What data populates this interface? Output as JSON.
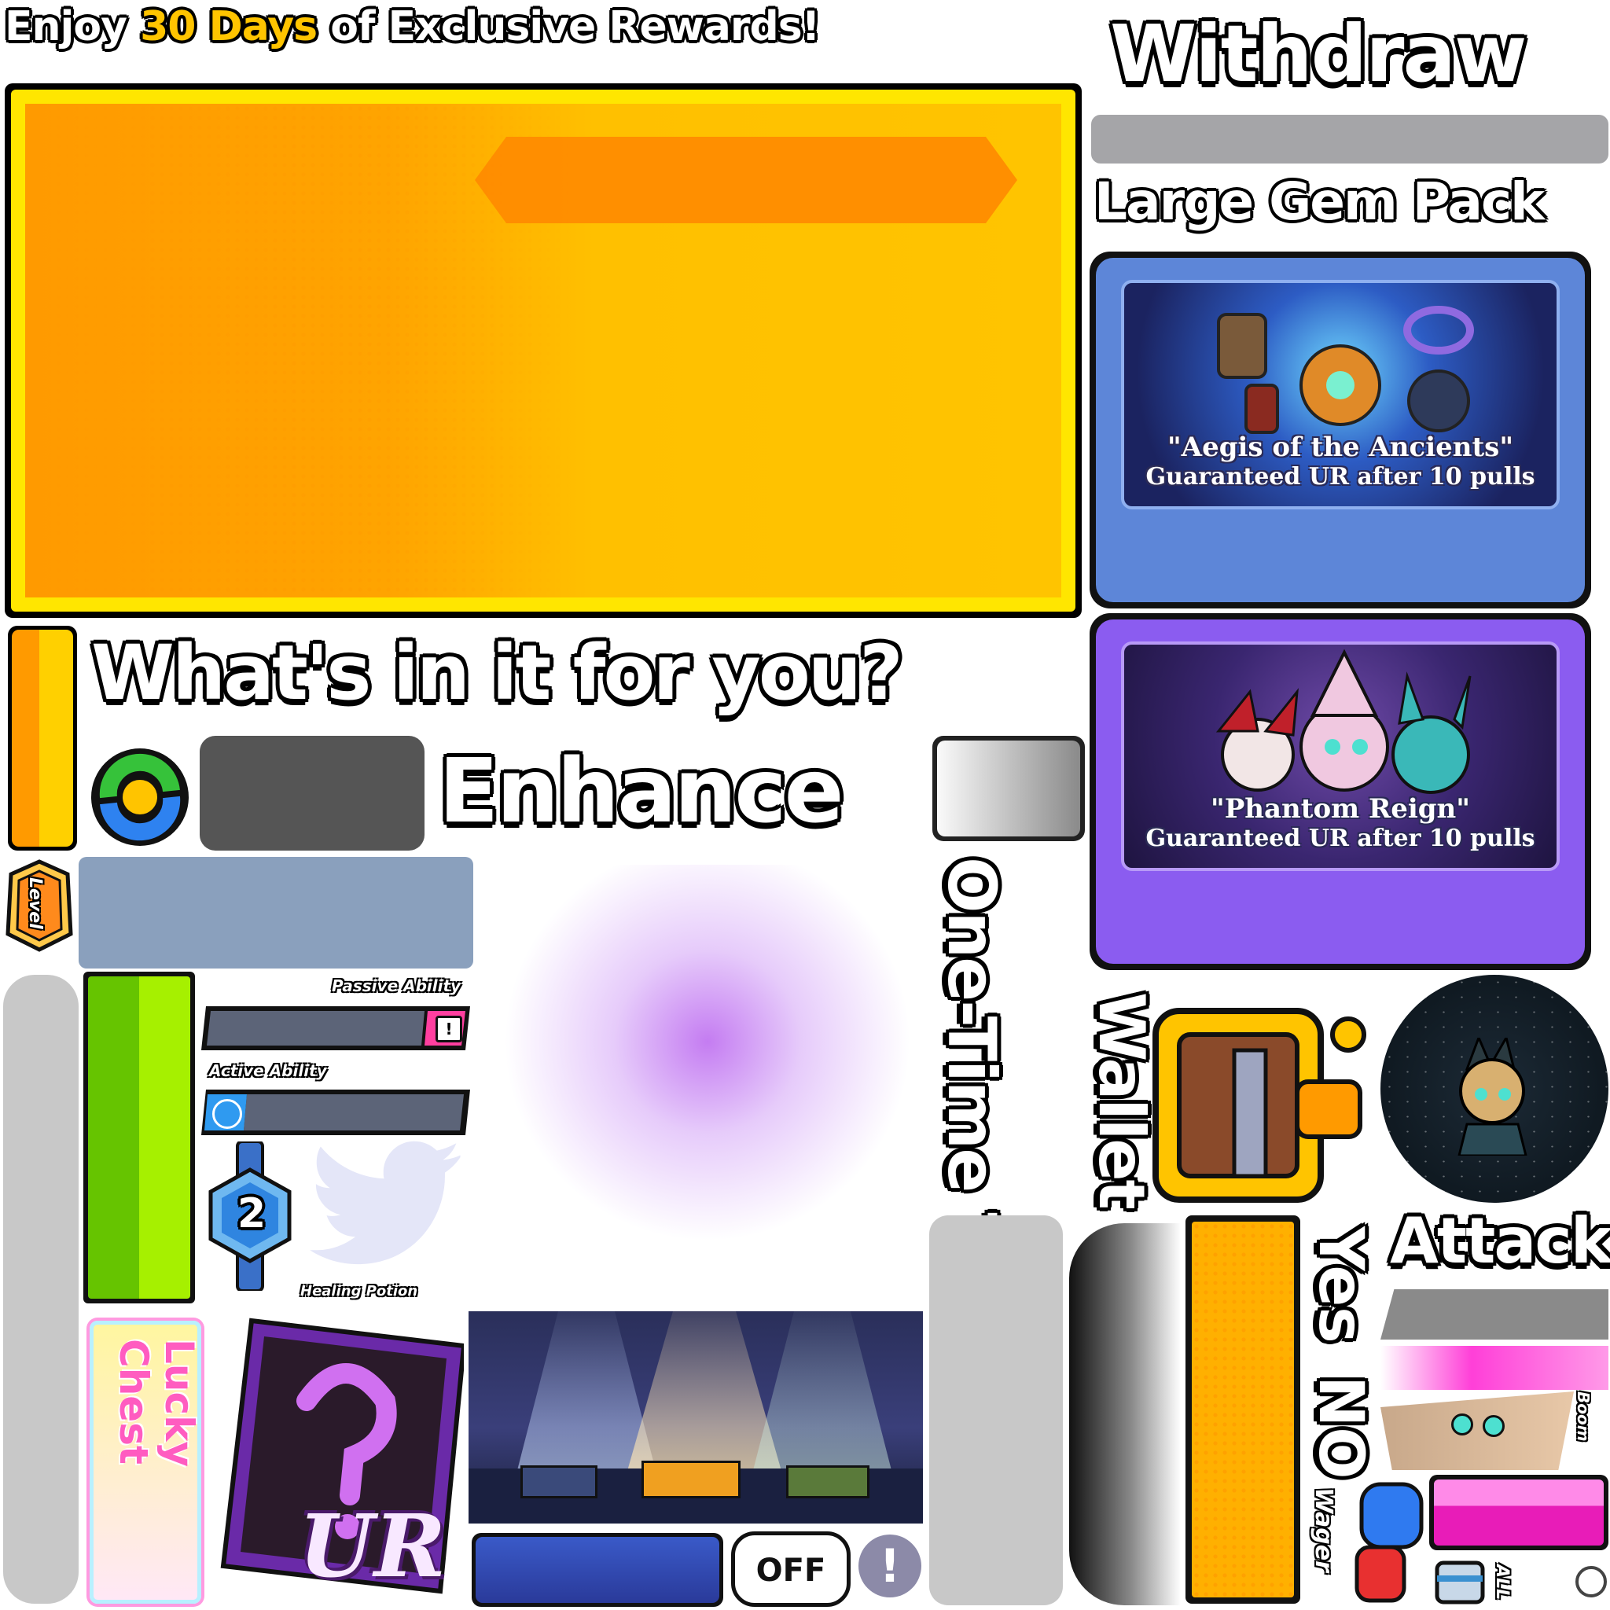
{
  "top_banner": {
    "prefix": "Enjoy",
    "highlight": "30 Days",
    "suffix": "of Exclusive Rewards!"
  },
  "titles": {
    "withdraw": "Withdraw",
    "large_gem_pack": "Large Gem Pack",
    "whats_in_it": "What's in it for you?",
    "enhance": "Enhance",
    "one_time_tasks": "One-Time Tasks",
    "wallet": "Wallet",
    "attack": "Attack",
    "yes": "Yes",
    "no": "NO"
  },
  "gacha_banners": [
    {
      "title": "\"Aegis of the Ancients\"",
      "subtitle": "Guaranteed UR after 10 pulls",
      "accent": "#5b7fd6"
    },
    {
      "title": "\"Phantom Reign\"",
      "subtitle": "Guaranteed UR after 10 pulls",
      "accent": "#8b5cf0"
    }
  ],
  "labels": {
    "level": "Level",
    "passive_ability": "Passive Ability",
    "active_ability": "Active Ability",
    "healing_potion": "Healing Potion",
    "lucky_chest": "Lucky Chest",
    "ur": "UR",
    "off": "OFF",
    "exclamation": "!",
    "boom": "Boom",
    "wager": "Wager",
    "all": "ALL",
    "rank_number": "2"
  },
  "icons": [
    "refresh-icon",
    "level-badge-icon",
    "info-icon",
    "target-icon",
    "rank-badge-icon",
    "twitter-icon",
    "mystery-card-icon",
    "wallet-icon",
    "fist-icon",
    "chest-icon",
    "exclamation-icon"
  ],
  "colors": {
    "orange": "#ff9a00",
    "yellow": "#ffc400",
    "green": "#88e000",
    "slate": "#5c6478",
    "gray_blue": "#8aa0bd",
    "pink": "#ff3fc8"
  }
}
